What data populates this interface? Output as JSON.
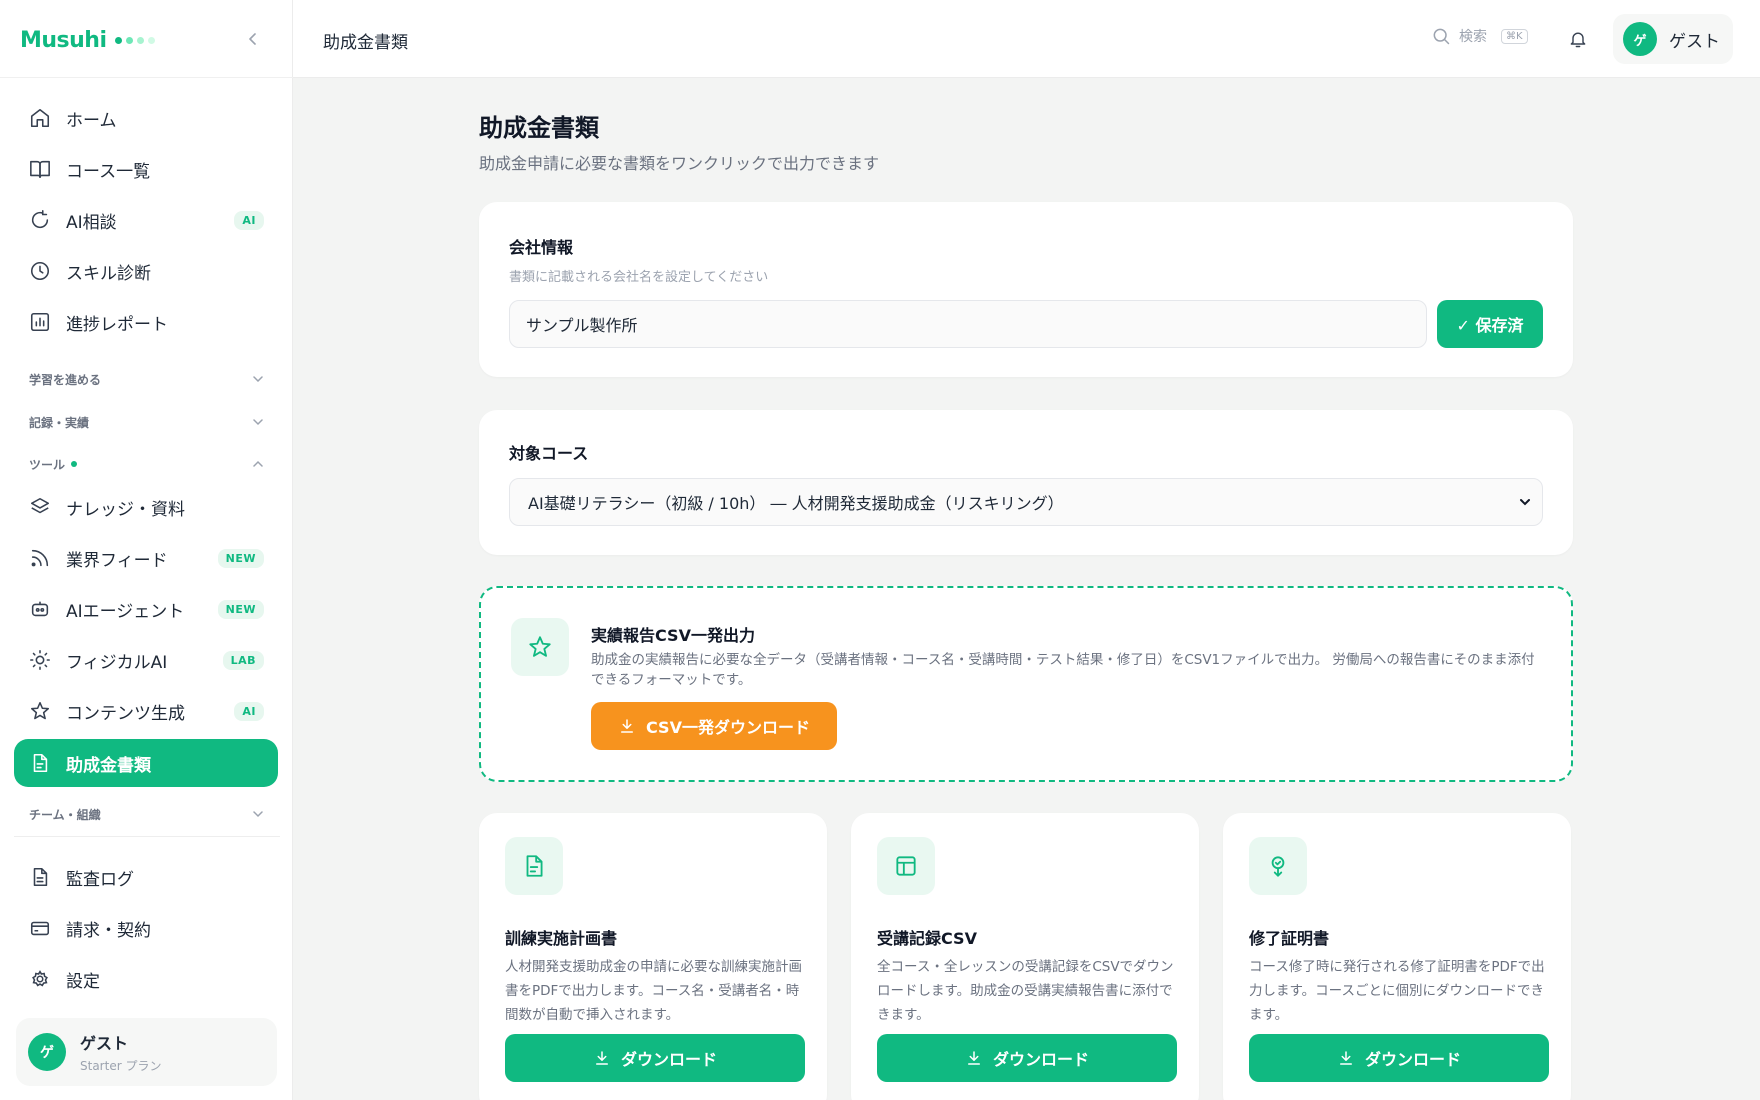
{
  "brand": {
    "name": "Musuhi"
  },
  "topbar": {
    "title": "助成金書類",
    "search_label": "検索",
    "search_shortcut": "⌘K",
    "user_initial": "ゲ",
    "user_name": "ゲスト"
  },
  "sidebar": {
    "main_items": [
      {
        "label": "ホーム",
        "icon": "home-icon"
      },
      {
        "label": "コース一覧",
        "icon": "book-icon"
      },
      {
        "label": "AI相談",
        "icon": "refresh-icon",
        "badge": "AI"
      },
      {
        "label": "スキル診断",
        "icon": "clock-icon"
      },
      {
        "label": "進捗レポート",
        "icon": "chart-icon"
      }
    ],
    "sections": [
      {
        "label": "学習を進める"
      },
      {
        "label": "記録・実績"
      },
      {
        "label": "ツール"
      },
      {
        "label": "チーム・組織"
      }
    ],
    "tool_items": [
      {
        "label": "ナレッジ・資料",
        "icon": "layers-icon"
      },
      {
        "label": "業界フィード",
        "icon": "rss-icon",
        "badge": "NEW"
      },
      {
        "label": "AIエージェント",
        "icon": "bot-icon",
        "badge": "NEW"
      },
      {
        "label": "フィジカルAI",
        "icon": "sun-icon",
        "badge": "LAB"
      },
      {
        "label": "コンテンツ生成",
        "icon": "star-icon",
        "badge": "AI"
      },
      {
        "label": "助成金書類",
        "icon": "document-icon"
      }
    ],
    "bottom_items": [
      {
        "label": "監査ログ",
        "icon": "file-icon"
      },
      {
        "label": "請求・契約",
        "icon": "card-icon"
      },
      {
        "label": "設定",
        "icon": "gear-icon"
      }
    ],
    "user": {
      "initial": "ゲ",
      "name": "ゲスト",
      "plan": "Starter プラン"
    }
  },
  "main": {
    "title": "助成金書類",
    "subtitle": "助成金申請に必要な書類をワンクリックで出力できます",
    "company": {
      "title": "会社情報",
      "subtitle": "書類に記載される会社名を設定してください",
      "input_value": "サンプル製作所",
      "save_label": "✓ 保存済"
    },
    "course": {
      "title": "対象コース",
      "selected": "AI基礎リテラシー（初級 / 10h） ― 人材開発支援助成金（リスキリング）"
    },
    "csv_export": {
      "title": "実績報告CSV一発出力",
      "description": "助成金の実績報告に必要な全データ（受講者情報・コース名・受講時間・テスト結果・修了日）をCSV1ファイルで出力。 労働局への報告書にそのまま添付できるフォーマットです。",
      "button_label": "CSV一発ダウンロード"
    },
    "documents": [
      {
        "title": "訓練実施計画書",
        "description": "人材開発支援助成金の申請に必要な訓練実施計画書をPDFで出力します。コース名・受講者名・時間数が自動で挿入されます。",
        "button_label": "ダウンロード"
      },
      {
        "title": "受講記録CSV",
        "description": "全コース・全レッスンの受講記録をCSVでダウンロードします。助成金の受講実績報告書に添付できます。",
        "button_label": "ダウンロード"
      },
      {
        "title": "修了証明書",
        "description": "コース修了時に発行される修了証明書をPDFで出力します。コースごとに個別にダウンロードできます。",
        "button_label": "ダウンロード"
      }
    ]
  },
  "colors": {
    "accent": "#10b981",
    "orange": "#f7931e"
  }
}
